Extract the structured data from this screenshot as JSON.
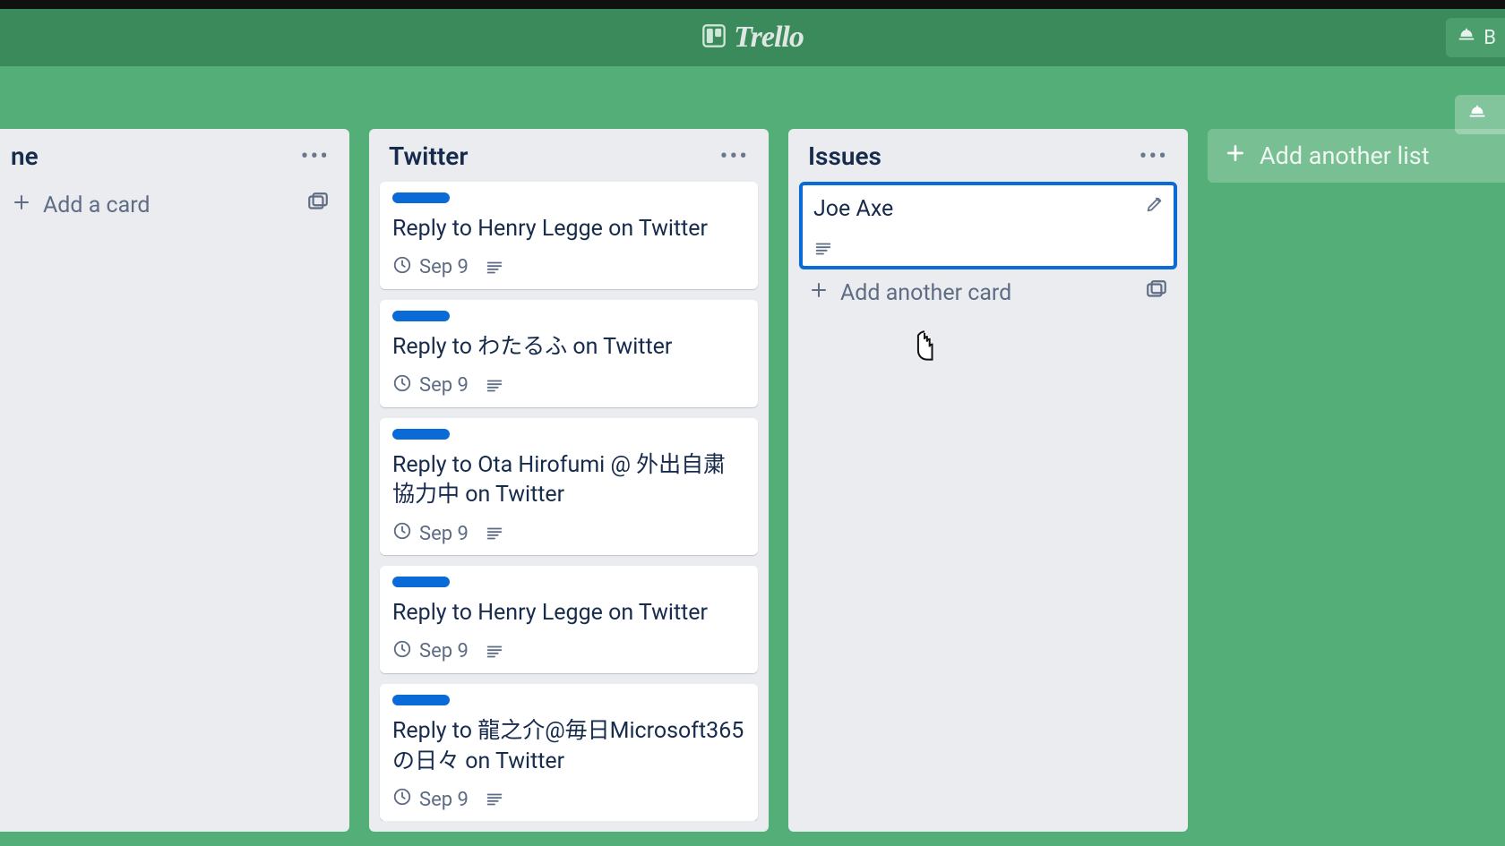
{
  "brand": {
    "name": "Trello"
  },
  "header_right": {
    "letter": "B"
  },
  "board_right": {
    "letter": ""
  },
  "lists": [
    {
      "title_fragment": "ne",
      "add_label": "Add a card"
    },
    {
      "title": "Twitter",
      "cards": [
        {
          "label_color": "#0a6bd6",
          "title": "Reply to Henry Legge on Twitter",
          "due": "Sep 9",
          "has_desc": true
        },
        {
          "label_color": "#0a6bd6",
          "title": "Reply to わたるふ on Twitter",
          "due": "Sep 9",
          "has_desc": true
        },
        {
          "label_color": "#0a6bd6",
          "title": "Reply to Ota Hirofumi @ 外出自粛協力中 on Twitter",
          "due": "Sep 9",
          "has_desc": true
        },
        {
          "label_color": "#0a6bd6",
          "title": "Reply to Henry Legge on Twitter",
          "due": "Sep 9",
          "has_desc": true
        },
        {
          "label_color": "#0a6bd6",
          "title": "Reply to 龍之介@毎日Microsoft365の日々 on Twitter",
          "due": "Sep 9",
          "has_desc": true
        }
      ]
    },
    {
      "title": "Issues",
      "cards": [
        {
          "title": "Joe Axe",
          "has_desc": true,
          "highlight": true
        }
      ],
      "add_label": "Add another card"
    }
  ],
  "add_list_label": "Add another list"
}
